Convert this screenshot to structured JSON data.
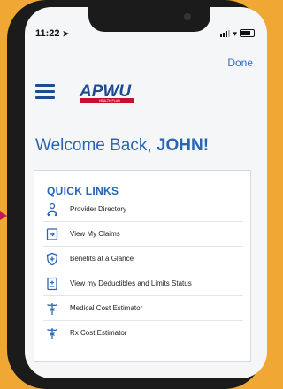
{
  "status_bar": {
    "time": "11:22"
  },
  "nav": {
    "done_label": "Done"
  },
  "logo": {
    "text": "APWU",
    "subtext": "HEALTH PLAN"
  },
  "welcome": {
    "prefix": "Welcome Back, ",
    "name": "JOHN!"
  },
  "quick_links": {
    "title": "QUICK LINKS",
    "items": [
      {
        "label": "Provider Directory",
        "icon": "provider-directory-icon"
      },
      {
        "label": "View My Claims",
        "icon": "claims-icon"
      },
      {
        "label": "Benefits at a Glance",
        "icon": "benefits-shield-icon"
      },
      {
        "label": "View my Deductibles and Limits Status",
        "icon": "deductibles-icon"
      },
      {
        "label": "Medical Cost Estimator",
        "icon": "caduceus-icon"
      },
      {
        "label": "Rx Cost Estimator",
        "icon": "caduceus-icon"
      }
    ]
  },
  "colors": {
    "background": "#f0a733",
    "accent_blue": "#2a64b4",
    "pointer": "#c0185a"
  }
}
